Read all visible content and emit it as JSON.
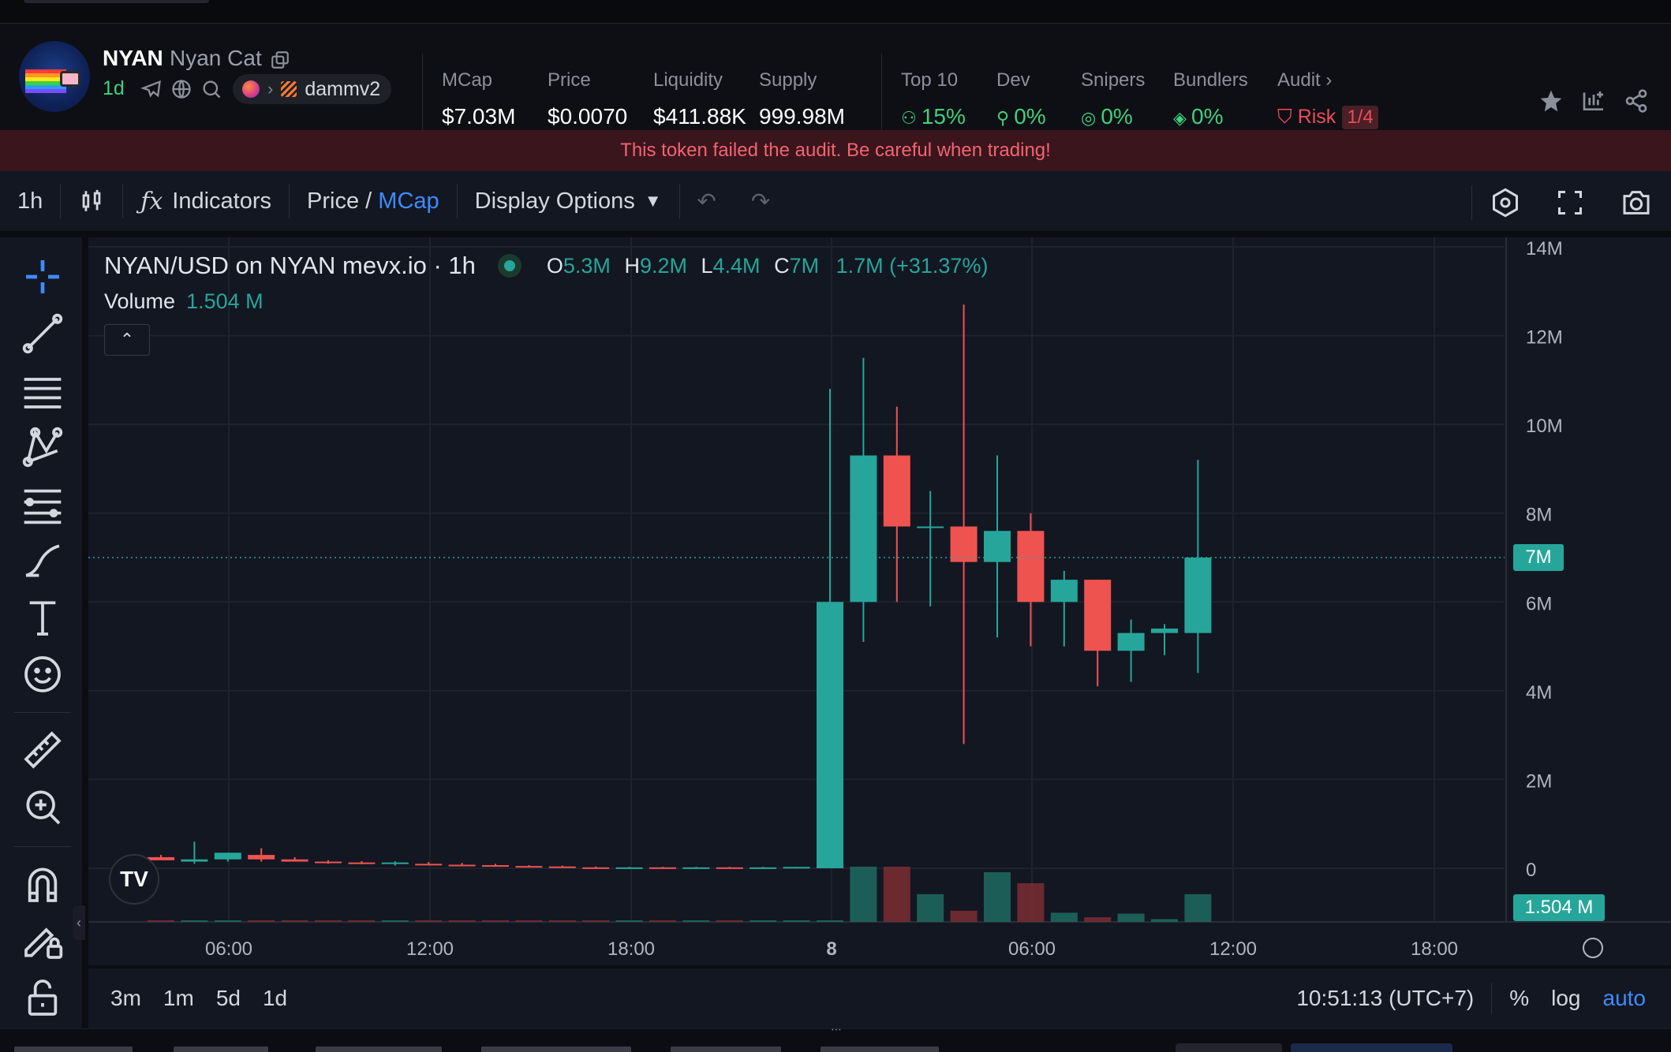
{
  "token": {
    "symbol": "NYAN",
    "name": "Nyan Cat",
    "age": "1d",
    "pool": "dammv2"
  },
  "stats": [
    {
      "label": "MCap",
      "value": "$7.03M"
    },
    {
      "label": "Price",
      "value": "$0.0070"
    },
    {
      "label": "Liquidity",
      "value": "$411.88K"
    },
    {
      "label": "Supply",
      "value": "999.98M"
    }
  ],
  "holders": [
    {
      "label": "Top 10",
      "value": "15%"
    },
    {
      "label": "Dev",
      "value": "0%"
    },
    {
      "label": "Snipers",
      "value": "0%"
    },
    {
      "label": "Bundlers",
      "value": "0%"
    }
  ],
  "audit": {
    "label": "Audit",
    "risk_label": "Risk",
    "risk_value": "1/4"
  },
  "warning": "This token failed the audit. Be careful when trading!",
  "toolbar": {
    "interval": "1h",
    "indicators": "Indicators",
    "price_label": "Price",
    "slash": " / ",
    "mcap_label": "MCap",
    "display_options": "Display Options"
  },
  "legend": {
    "pair": "NYAN/USD on NYAN mevx.io · 1h",
    "o_label": "O",
    "o": "5.3M",
    "h_label": "H",
    "h": "9.2M",
    "l_label": "L",
    "l": "4.4M",
    "c_label": "C",
    "c": "7M",
    "change": "1.7M (+31.37%)",
    "volume_label": "Volume",
    "volume_value": "1.504 M"
  },
  "last_price_tag": "7M",
  "volume_tag": "1.504 M",
  "bottom": {
    "ranges": [
      "3m",
      "1m",
      "5d",
      "1d"
    ],
    "clock": "10:51:13 (UTC+7)",
    "percent": "%",
    "log": "log",
    "auto": "auto"
  },
  "colors": {
    "up": "#26a69a",
    "down": "#ef5350",
    "accent": "#3d8bfd",
    "warning": "#f26473"
  },
  "chart_data": {
    "type": "candlestick",
    "title": "NYAN/USD on NYAN mevx.io · 1h",
    "y_ticks": [
      "14M",
      "12M",
      "10M",
      "8M",
      "6M",
      "4M",
      "2M",
      "0"
    ],
    "ylim": [
      0,
      14000000
    ],
    "x_ticks": [
      "06:00",
      "12:00",
      "18:00",
      "8",
      "06:00",
      "12:00",
      "18:00"
    ],
    "candles": [
      {
        "time": "03:00",
        "open": 250000,
        "high": 300000,
        "low": 200000,
        "close": 180000
      },
      {
        "time": "04:00",
        "open": 150000,
        "high": 600000,
        "low": 100000,
        "close": 200000
      },
      {
        "time": "05:00",
        "open": 200000,
        "high": 350000,
        "low": 150000,
        "close": 350000
      },
      {
        "time": "06:00",
        "open": 300000,
        "high": 450000,
        "low": 150000,
        "close": 200000
      },
      {
        "time": "07:00",
        "open": 200000,
        "high": 250000,
        "low": 150000,
        "close": 150000
      },
      {
        "time": "08:00",
        "open": 150000,
        "high": 180000,
        "low": 100000,
        "close": 120000
      },
      {
        "time": "09:00",
        "open": 130000,
        "high": 160000,
        "low": 90000,
        "close": 110000
      },
      {
        "time": "10:00",
        "open": 100000,
        "high": 160000,
        "low": 60000,
        "close": 130000
      },
      {
        "time": "11:00",
        "open": 100000,
        "high": 140000,
        "low": 80000,
        "close": 80000
      },
      {
        "time": "12:00",
        "open": 80000,
        "high": 120000,
        "low": 60000,
        "close": 70000
      },
      {
        "time": "13:00",
        "open": 70000,
        "high": 100000,
        "low": 40000,
        "close": 50000
      },
      {
        "time": "14:00",
        "open": 50000,
        "high": 70000,
        "low": 20000,
        "close": 40000
      },
      {
        "time": "15:00",
        "open": 40000,
        "high": 60000,
        "low": 20000,
        "close": 20000
      },
      {
        "time": "16:00",
        "open": 20000,
        "high": 40000,
        "low": 0,
        "close": 10000
      },
      {
        "time": "17:00",
        "open": 10000,
        "high": 30000,
        "low": 0,
        "close": 20000
      },
      {
        "time": "18:00",
        "open": 20000,
        "high": 30000,
        "low": 0,
        "close": 10000
      },
      {
        "time": "19:00",
        "open": 10000,
        "high": 30000,
        "low": 0,
        "close": 20000
      },
      {
        "time": "20:00",
        "open": 20000,
        "high": 30000,
        "low": 0,
        "close": 10000
      },
      {
        "time": "21:00",
        "open": 10000,
        "high": 30000,
        "low": 0,
        "close": 20000
      },
      {
        "time": "22:00",
        "open": 20000,
        "high": 30000,
        "low": 0,
        "close": 30000
      },
      {
        "time": "23:00",
        "open": 0,
        "high": 10800000,
        "low": 0,
        "close": 6000000
      },
      {
        "time": "00:00",
        "open": 6000000,
        "high": 11500000,
        "low": 5100000,
        "close": 9300000
      },
      {
        "time": "01:00",
        "open": 9300000,
        "high": 10400000,
        "low": 6000000,
        "close": 7700000
      },
      {
        "time": "02:00",
        "open": 7700000,
        "high": 8500000,
        "low": 5900000,
        "close": 7700000
      },
      {
        "time": "03:00",
        "open": 7700000,
        "high": 12700000,
        "low": 2800000,
        "close": 6900000
      },
      {
        "time": "04:00",
        "open": 6900000,
        "high": 9300000,
        "low": 5200000,
        "close": 7600000
      },
      {
        "time": "05:00",
        "open": 7600000,
        "high": 8000000,
        "low": 5000000,
        "close": 6000000
      },
      {
        "time": "06:00",
        "open": 6000000,
        "high": 6700000,
        "low": 5000000,
        "close": 6500000
      },
      {
        "time": "07:00",
        "open": 6500000,
        "high": 6500000,
        "low": 4100000,
        "close": 4900000
      },
      {
        "time": "08:00",
        "open": 4900000,
        "high": 5600000,
        "low": 4200000,
        "close": 5300000
      },
      {
        "time": "09:00",
        "open": 5300000,
        "high": 5500000,
        "low": 4800000,
        "close": 5400000
      },
      {
        "time": "10:00",
        "open": 5300000,
        "high": 9200000,
        "low": 4400000,
        "close": 7000000
      }
    ],
    "volume": [
      40000,
      60000,
      15000,
      10000,
      5000,
      5000,
      4000,
      4000,
      3000,
      3000,
      3000,
      3000,
      2000,
      2000,
      2000,
      2000,
      2000,
      2000,
      2000,
      2000,
      2000,
      3000000,
      3000000,
      1504000,
      608000,
      2700000,
      2100000,
      500000,
      250000,
      450000,
      150000,
      1504000
    ],
    "last_price": 7000000,
    "grid": true,
    "y_axis_position": "right"
  }
}
